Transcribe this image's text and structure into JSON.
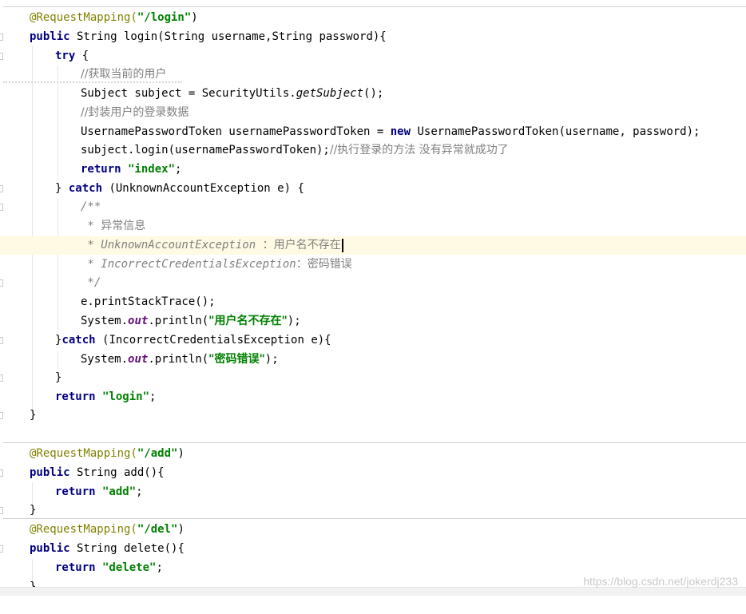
{
  "editor": {
    "method_login": {
      "annotation": "@RequestMapping(",
      "path": "\"/login\"",
      "close": ")",
      "kw_public": "public",
      "signature": " String login(String username,String password){",
      "kw_try": "try",
      "brace_open": " {",
      "comment_current_user": "//获取当前的用户",
      "subject_line": "Subject subject = SecurityUtils.",
      "get_subject": "getSubject",
      "subject_end": "();",
      "comment_wrap": "//封装用户的登录数据",
      "token_decl": "UsernamePasswordToken usernamePasswordToken = ",
      "kw_new": "new",
      "token_ctor": " UsernamePasswordToken(username, password);",
      "login_call": "subject.login(usernamePasswordToken);",
      "comment_login": "//执行登录的方法 没有异常就成功了",
      "kw_return": "return",
      "return_index": " \"index\"",
      "semicolon": ";",
      "catch1_brace": "} ",
      "kw_catch": "catch",
      "catch1_type": " (UnknownAccountException e) {",
      "doc_open": "/**",
      "doc_line1_star": " * ",
      "doc_line1_text": "异常信息",
      "doc_line2_star": " * UnknownAccountException ",
      "doc_line2_text": "：用户名不存在",
      "doc_line3_star": " * IncorrectCredentialsException",
      "doc_line3_text": "：密码错误",
      "doc_close": " */",
      "print_stack": "e.printStackTrace();",
      "sys": "System.",
      "out": "out",
      "println": ".println(",
      "msg_user": "\"用户名不存在\"",
      "println_end": ");",
      "catch2_brace": "}",
      "catch2_type": " (IncorrectCredentialsException e){",
      "msg_pwd": "\"密码错误\"",
      "close_brace": "}",
      "return_login": " \"login\""
    },
    "method_add": {
      "annotation": "@RequestMapping(",
      "path": "\"/add\"",
      "close": ")",
      "signature": " String add(){",
      "return_add": " \"add\""
    },
    "method_del": {
      "annotation": "@RequestMapping(",
      "path": "\"/del\"",
      "close": ")",
      "signature": " String delete(){",
      "return_delete": " \"delete\""
    }
  },
  "watermark": "https://blog.csdn.net/jokerdj233"
}
